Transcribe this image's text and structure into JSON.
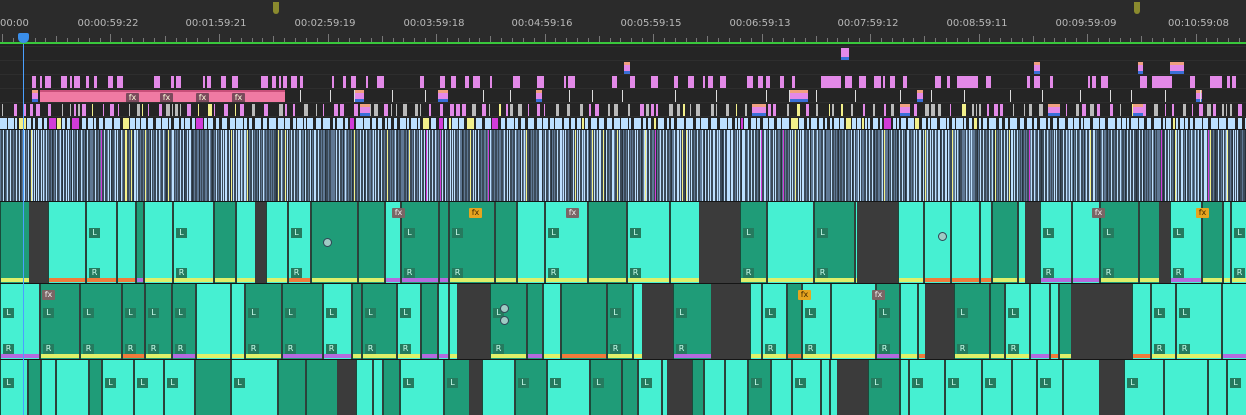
{
  "ruler": {
    "timecodes": [
      "00:00",
      "00:00:59:22",
      "00:01:59:21",
      "00:02:59:19",
      "00:03:59:18",
      "00:04:59:16",
      "00:05:59:15",
      "00:06:59:13",
      "00:07:59:12",
      "00:08:59:11",
      "00:09:59:09",
      "00:10:59:08"
    ]
  },
  "playhead": {
    "timecode": "00:00"
  },
  "badges": {
    "fx": "fx",
    "left": "L",
    "right": "R"
  },
  "colors": {
    "background": "#232323",
    "ruler": "#2b2b2b",
    "work_area": "#39c73c",
    "playhead": "#3a8eea",
    "video_clip_pink": "#e389e8",
    "video_clip_salmon": "#f07aa3",
    "audio_clip_cyan": "#46f0d2",
    "audio_clip_teal": "#2fbf94",
    "waveform_blue": "#bde0ff",
    "marker_yellow": "#f3f08a",
    "marker_magenta": "#d23bd8"
  }
}
